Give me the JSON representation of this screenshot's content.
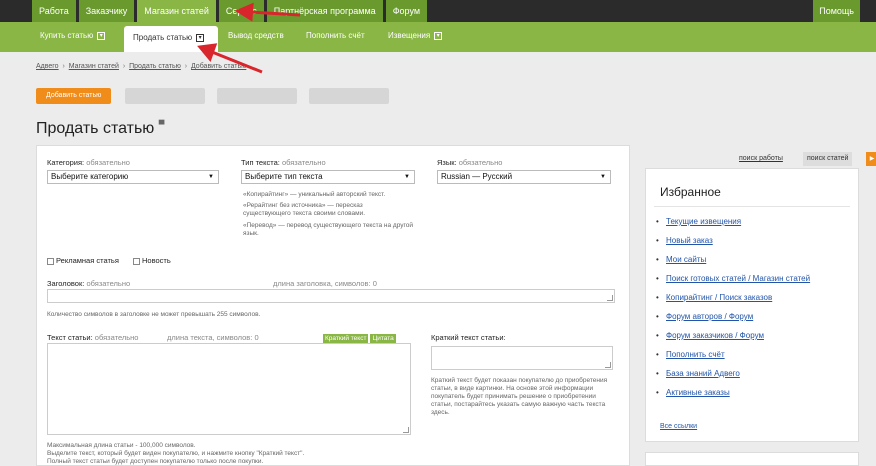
{
  "topnav": {
    "tabs": [
      "Работа",
      "Заказчику",
      "Магазин статей",
      "Сервис",
      "Партнёрская программа",
      "Форум"
    ],
    "help": "Помощь"
  },
  "subnav": {
    "items": [
      "Купить статью",
      "Продать статью",
      "Вывод средств",
      "Пополнить счёт",
      "Извещения"
    ]
  },
  "breadcrumb": [
    "Адвего",
    "Магазин статей",
    "Продать статью",
    "Добавить статью"
  ],
  "buttons": {
    "add_article": "Добавить статью"
  },
  "page_title": "Продать статью",
  "form": {
    "category_label": "Категория:",
    "category_required": "обязательно",
    "category_value": "Выберите категорию",
    "type_label": "Тип текста:",
    "type_required": "обязательно",
    "type_value": "Выберите тип текста",
    "lang_label": "Язык:",
    "lang_required": "обязательно",
    "lang_value": "Russian — Русский",
    "type_hints": [
      "«Копирайтинг» — уникальный авторский текст.",
      "«Рерайтинг без источника» — пересказ существующего текста своими словами.",
      "«Перевод» — перевод существующего текста на другой язык."
    ],
    "checkbox_ad": "Рекламная статья",
    "checkbox_news": "Новость",
    "headline_label": "Заголовок:",
    "headline_required": "обязательно",
    "headline_length": "длина заголовка, символов: 0",
    "headline_note": "Количество символов в заголовке не может превышать 255 символов.",
    "text_label": "Текст статьи:",
    "text_required": "обязательно",
    "text_length": "длина текста, символов: 0",
    "btn_short": "Краткий текст",
    "btn_quote": "Цитата",
    "short_label": "Краткий текст статьи:",
    "short_hint": "Краткий текст будет показан покупателю до приобретения статьи, в виде картинки. На основе этой информации покупатель будет принимать решение о приобретении статьи, постарайтесь указать самую важную часть текста здесь.",
    "max_note_1": "Максимальная длина статьи - 100,000 символов.",
    "max_note_2": "Выделите текст, который будет виден покупателю, и нажмите кнопку \"Краткий текст\".",
    "max_note_3": "Полный текст статьи будет доступен покупателю только после покупки."
  },
  "right": {
    "search_work": "поиск работы",
    "search_articles": "поиск статей",
    "fav_title": "Избранное",
    "fav_links": [
      "Текущие извещения",
      "Новый заказ",
      "Мои сайты",
      "Поиск готовых статей / Магазин статей",
      "Копирайтинг / Поиск заказов",
      "Форум авторов / Форум",
      "Форум заказчиков / Форум",
      "Пополнить счёт",
      "База знаний Адвего",
      "Активные заказы"
    ],
    "all_links": "Все ссылки"
  },
  "colors": {
    "green": "#8ab646",
    "dark_green": "#6a9a2e",
    "orange": "#f08c1a",
    "arrow": "#d9262c"
  }
}
